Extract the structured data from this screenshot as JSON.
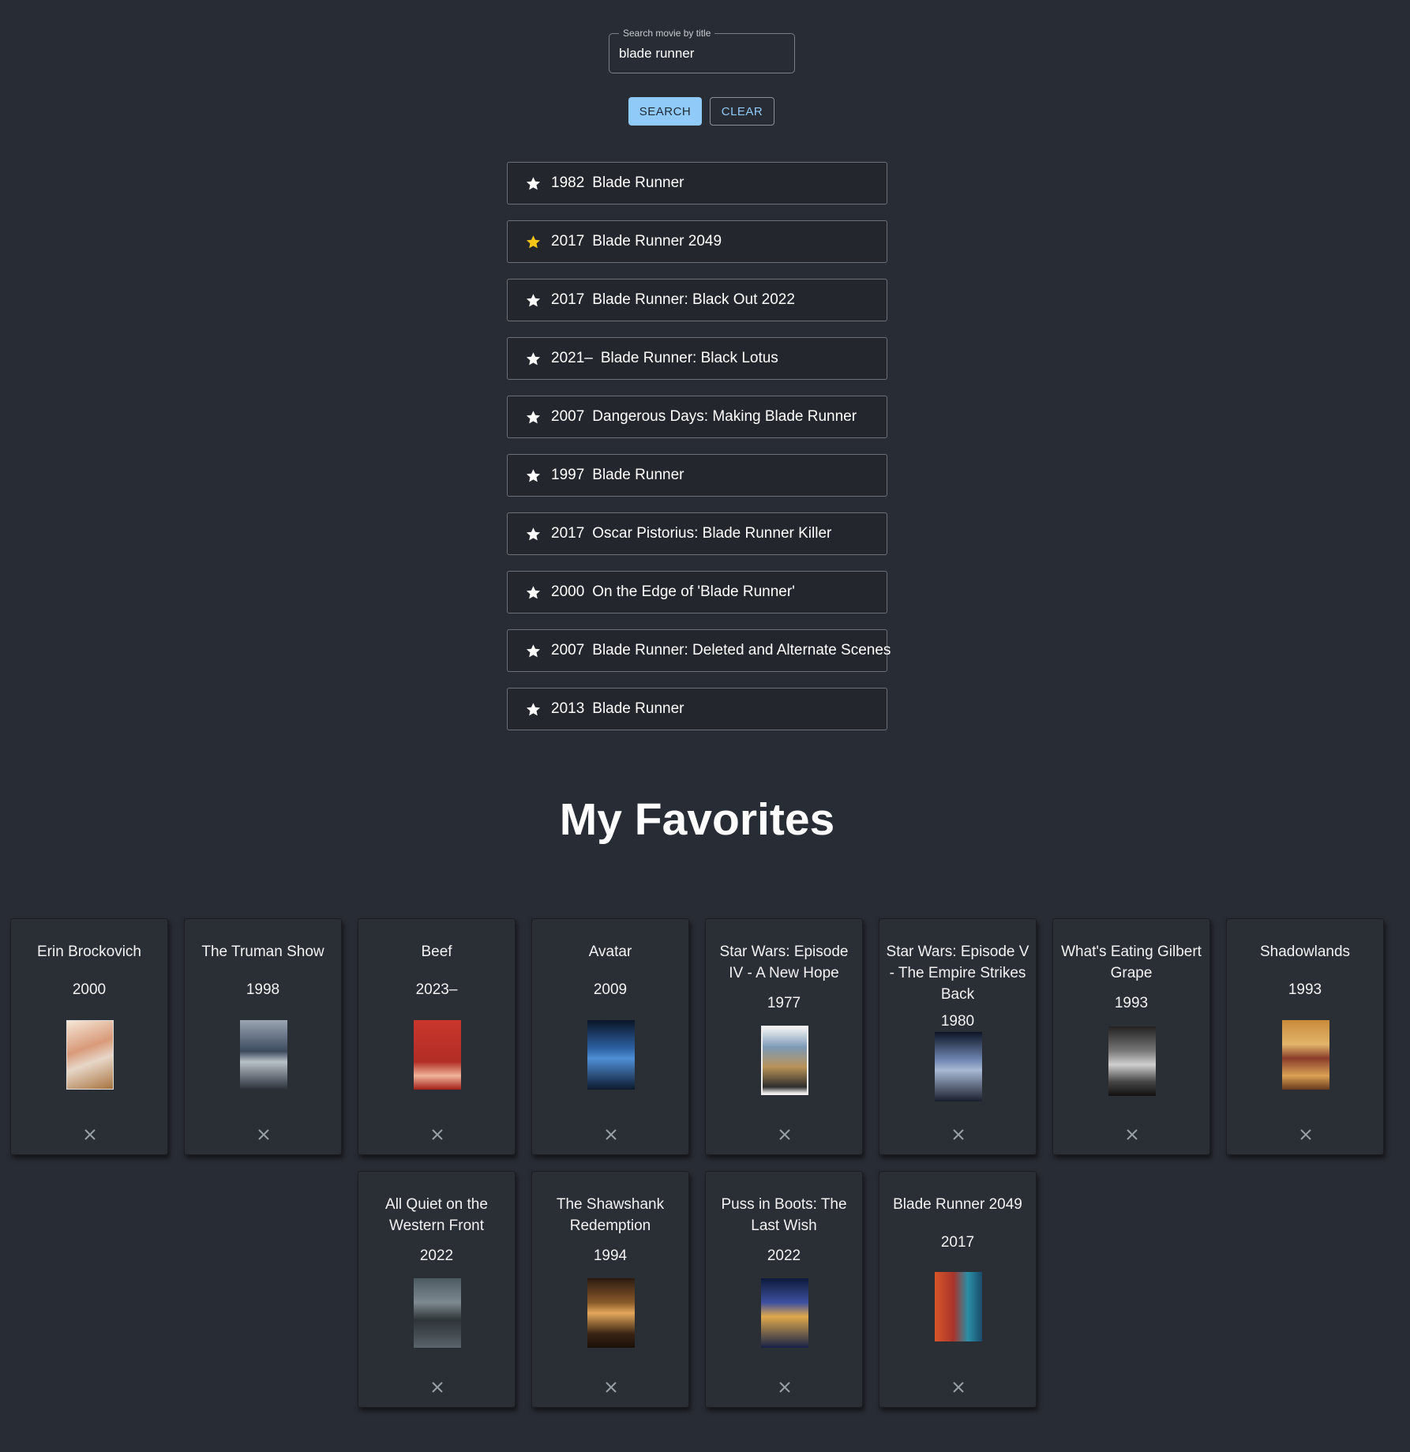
{
  "search": {
    "legend": "Search movie by title",
    "value": "blade runner",
    "search_label": "SEARCH",
    "clear_label": "CLEAR"
  },
  "colors": {
    "background": "#282c34",
    "accent": "#90caf9",
    "favorite_star": "#f5c518"
  },
  "results": [
    {
      "year": "1982",
      "title": "Blade Runner",
      "favorite": false
    },
    {
      "year": "2017",
      "title": "Blade Runner 2049",
      "favorite": true
    },
    {
      "year": "2017",
      "title": "Blade Runner: Black Out 2022",
      "favorite": false
    },
    {
      "year": "2021–",
      "title": "Blade Runner: Black Lotus",
      "favorite": false
    },
    {
      "year": "2007",
      "title": "Dangerous Days: Making Blade Runner",
      "favorite": false
    },
    {
      "year": "1997",
      "title": "Blade Runner",
      "favorite": false
    },
    {
      "year": "2017",
      "title": "Oscar Pistorius: Blade Runner Killer",
      "favorite": false
    },
    {
      "year": "2000",
      "title": "On the Edge of 'Blade Runner'",
      "favorite": false
    },
    {
      "year": "2007",
      "title": "Blade Runner: Deleted and Alternate Scenes",
      "favorite": false
    },
    {
      "year": "2013",
      "title": "Blade Runner",
      "favorite": false
    }
  ],
  "favorites": {
    "heading": "My Favorites",
    "items": [
      {
        "title": "Erin Brockovich",
        "year": "2000"
      },
      {
        "title": "The Truman Show",
        "year": "1998"
      },
      {
        "title": "Beef",
        "year": "2023–"
      },
      {
        "title": "Avatar",
        "year": "2009"
      },
      {
        "title": "Star Wars: Episode IV - A New Hope",
        "year": "1977"
      },
      {
        "title": "Star Wars: Episode V - The Empire Strikes Back",
        "year": "1980"
      },
      {
        "title": "What's Eating Gilbert Grape",
        "year": "1993"
      },
      {
        "title": "Shadowlands",
        "year": "1993"
      },
      {
        "title": "All Quiet on the Western Front",
        "year": "2022"
      },
      {
        "title": "The Shawshank Redemption",
        "year": "1994"
      },
      {
        "title": "Puss in Boots: The Last Wish",
        "year": "2022"
      },
      {
        "title": "Blade Runner 2049",
        "year": "2017"
      }
    ]
  }
}
